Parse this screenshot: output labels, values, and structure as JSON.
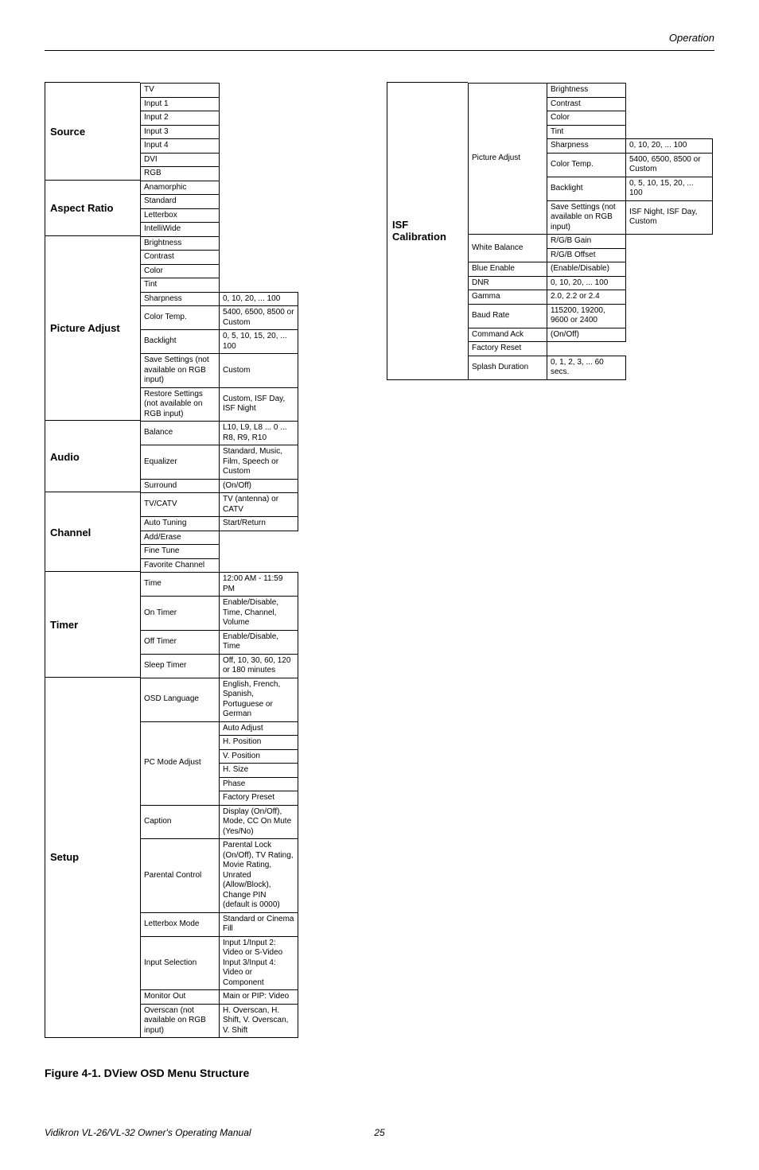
{
  "header": {
    "section": "Operation"
  },
  "figure_caption": "Figure 4-1. DView OSD Menu Structure",
  "footer": {
    "left": "Vidikron VL-26/VL-32 Owner's Operating Manual",
    "page": "25"
  },
  "left": [
    {
      "label": "Source",
      "groups": [
        {
          "rows": [
            {
              "t": "TV"
            },
            {
              "t": "Input 1"
            },
            {
              "t": "Input 2"
            },
            {
              "t": "Input 3"
            },
            {
              "t": "Input 4"
            },
            {
              "t": "DVI"
            },
            {
              "t": "RGB"
            }
          ]
        }
      ]
    },
    {
      "label": "Aspect Ratio",
      "groups": [
        {
          "rows": [
            {
              "t": "Anamorphic"
            },
            {
              "t": "Standard"
            },
            {
              "t": "Letterbox"
            },
            {
              "t": "IntelliWide"
            }
          ]
        }
      ]
    },
    {
      "label": "Picture Adjust",
      "groups": [
        {
          "rows": [
            {
              "t": "Brightness"
            },
            {
              "t": "Contrast"
            },
            {
              "t": "Color"
            },
            {
              "t": "Tint"
            },
            {
              "t": "Sharpness",
              "o": "0, 10, 20, ... 100"
            },
            {
              "t": "Color Temp.",
              "o": "5400, 6500, 8500 or Custom"
            },
            {
              "t": "Backlight",
              "o": "0, 5, 10, 15, 20, ... 100"
            },
            {
              "t": "Save Settings (not available on RGB input)",
              "o": "Custom"
            },
            {
              "t": "Restore Settings (not available on RGB input)",
              "o": "Custom, ISF Day, ISF Night"
            }
          ]
        }
      ]
    },
    {
      "label": "Audio",
      "groups": [
        {
          "rows": [
            {
              "t": "Balance",
              "o": "L10, L9, L8 ... 0 ... R8, R9, R10"
            },
            {
              "t": "Equalizer",
              "o": "Standard, Music, Film, Speech or Custom"
            },
            {
              "t": "Surround",
              "o": "(On/Off)"
            }
          ]
        }
      ]
    },
    {
      "label": "Channel",
      "groups": [
        {
          "rows": [
            {
              "t": "TV/CATV",
              "o": "TV (antenna) or CATV"
            },
            {
              "t": "Auto Tuning",
              "o": "Start/Return"
            },
            {
              "t": "Add/Erase"
            },
            {
              "t": "Fine Tune"
            },
            {
              "t": "Favorite Channel"
            }
          ]
        }
      ]
    },
    {
      "label": "Timer",
      "groups": [
        {
          "rows": [
            {
              "t": "Time",
              "o": "12:00 AM - 11:59 PM"
            },
            {
              "t": "On Timer",
              "o": "Enable/Disable, Time, Channel, Volume"
            },
            {
              "t": "Off Timer",
              "o": "Enable/Disable, Time"
            },
            {
              "t": "Sleep Timer",
              "o": "Off, 10, 30, 60, 120 or 180 minutes"
            }
          ]
        }
      ]
    },
    {
      "label": "Setup",
      "groups": [
        {
          "rows": [
            {
              "t": "OSD Language",
              "o": "English, French, Spanish, Portuguese or German"
            }
          ]
        },
        {
          "sub": "PC Mode Adjust",
          "rows": [
            {
              "o": "Auto Adjust"
            },
            {
              "o": "H. Position"
            },
            {
              "o": "V. Position"
            },
            {
              "o": "H. Size"
            },
            {
              "o": "Phase"
            },
            {
              "o": "Factory Preset"
            }
          ]
        },
        {
          "rows": [
            {
              "t": "Caption",
              "o": "Display (On/Off), Mode, CC On Mute (Yes/No)"
            },
            {
              "t": "Parental Control",
              "o": "Parental Lock (On/Off), TV Rating, Movie Rating, Unrated (Allow/Block), Change PIN (default is 0000)"
            },
            {
              "t": "Letterbox Mode",
              "o": "Standard or Cinema Fill"
            },
            {
              "t": "Input Selection",
              "o": "Input 1/Input 2: Video or S-Video\nInput 3/Input 4: Video or Component"
            },
            {
              "t": "Monitor Out",
              "o": "Main or PIP: Video"
            },
            {
              "t": "Overscan (not available on RGB input)",
              "o": "H. Overscan, H. Shift, V. Overscan, V. Shift"
            }
          ]
        }
      ]
    }
  ],
  "right": [
    {
      "label": "ISF Calibration",
      "groups": [
        {
          "sub": "Picture Adjust",
          "rows": [
            {
              "o": "Brightness"
            },
            {
              "o": "Contrast"
            },
            {
              "o": "Color"
            },
            {
              "o": "Tint"
            },
            {
              "o": "Sharpness",
              "o2": "0, 10, 20, ... 100"
            },
            {
              "o": "Color Temp.",
              "o2": "5400, 6500, 8500 or Custom"
            },
            {
              "o": "Backlight",
              "o2": "0, 5, 10, 15, 20, ... 100"
            },
            {
              "o": "Save Settings (not available on RGB input)",
              "o2": "ISF Night, ISF Day, Custom"
            }
          ]
        },
        {
          "sub": "White Balance",
          "rows": [
            {
              "o": "R/G/B Gain"
            },
            {
              "o": "R/G/B Offset"
            }
          ]
        },
        {
          "rows": [
            {
              "t": "Blue Enable",
              "o": "(Enable/Disable)"
            },
            {
              "t": "DNR",
              "o": "0, 10, 20, ... 100"
            },
            {
              "t": "Gamma",
              "o": "2.0, 2.2 or 2.4"
            },
            {
              "t": "Baud Rate",
              "o": "115200, 19200, 9600 or 2400"
            },
            {
              "t": "Command Ack",
              "o": "(On/Off)"
            },
            {
              "t": "Factory Reset"
            },
            {
              "t": "Splash Duration",
              "o": "0, 1, 2, 3, ... 60 secs."
            }
          ]
        }
      ]
    }
  ]
}
